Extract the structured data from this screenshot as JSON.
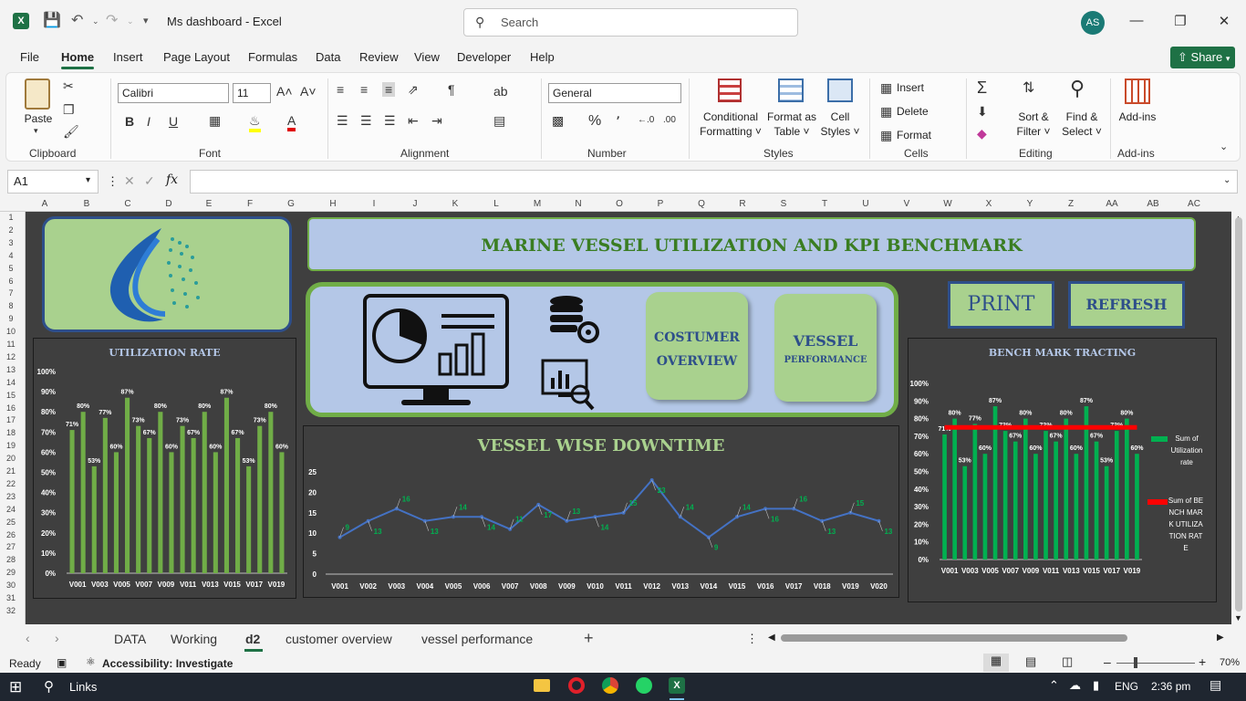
{
  "window": {
    "doc_title": "Ms dashboard  -  Excel",
    "search_placeholder": "Search",
    "avatar": "AS"
  },
  "menu": [
    "File",
    "Home",
    "Insert",
    "Page Layout",
    "Formulas",
    "Data",
    "Review",
    "View",
    "Developer",
    "Help"
  ],
  "share_label": "Share",
  "ribbon": {
    "paste": "Paste",
    "font_name": "Calibri",
    "font_size": "11",
    "number_format": "General",
    "conditional": [
      "Conditional",
      "Formatting"
    ],
    "format_table": [
      "Format as",
      "Table"
    ],
    "cell_styles": [
      "Cell",
      "Styles"
    ],
    "insert": "Insert",
    "delete": "Delete",
    "format": "Format",
    "sort": [
      "Sort &",
      "Filter"
    ],
    "find": [
      "Find &",
      "Select"
    ],
    "addins": "Add-ins",
    "groups": [
      "Clipboard",
      "Font",
      "Alignment",
      "Number",
      "Styles",
      "Cells",
      "Editing",
      "Add-ins"
    ]
  },
  "formula_bar": {
    "name_box": "A1",
    "fx": "fx"
  },
  "columns": [
    "A",
    "B",
    "C",
    "D",
    "E",
    "F",
    "G",
    "H",
    "I",
    "J",
    "K",
    "L",
    "M",
    "N",
    "O",
    "P",
    "Q",
    "R",
    "S",
    "T",
    "U",
    "V",
    "W",
    "X",
    "Y",
    "Z",
    "AA",
    "AB",
    "AC"
  ],
  "rows": [
    "1",
    "2",
    "3",
    "4",
    "5",
    "6",
    "7",
    "8",
    "9",
    "10",
    "11",
    "12",
    "13",
    "14",
    "15",
    "16",
    "17",
    "18",
    "19",
    "20",
    "21",
    "22",
    "23",
    "24",
    "25",
    "26",
    "27",
    "28",
    "29",
    "30",
    "31",
    "32"
  ],
  "dashboard": {
    "title": "MARINE VESSEL UTILIZATION AND KPI BENCHMARK",
    "btn_customer": [
      "COSTUMER",
      "OVERVIEW"
    ],
    "btn_vessel": [
      "VESSEL",
      "PERFORMANCE"
    ],
    "btn_print": "PRINT",
    "btn_refresh": "REFRESH",
    "colors": {
      "bg": "#3f3f3f",
      "green": "#a9d18e",
      "blue": "#b4c7e7",
      "bar": "#70ad47",
      "bench_bar": "#00b050",
      "line": "#4472c4",
      "bench_line": "#ff0000"
    }
  },
  "chart_data": [
    {
      "type": "bar",
      "title": "UTILIZATION RATE",
      "categories": [
        "V001",
        "V002",
        "V003",
        "V004",
        "V005",
        "V006",
        "V007",
        "V008",
        "V009",
        "V010",
        "V011",
        "V012",
        "V013",
        "V014",
        "V015",
        "V016",
        "V017",
        "V018",
        "V019",
        "V020"
      ],
      "tick_labels": [
        "V001",
        "V003",
        "V005",
        "V007",
        "V009",
        "V011",
        "V013",
        "V015",
        "V017",
        "V019"
      ],
      "values": [
        71,
        80,
        53,
        77,
        60,
        87,
        73,
        67,
        80,
        60,
        73,
        67,
        80,
        60,
        87,
        67,
        53,
        73,
        80,
        60
      ],
      "y_ticks": [
        "0%",
        "10%",
        "20%",
        "30%",
        "40%",
        "50%",
        "60%",
        "70%",
        "80%",
        "90%",
        "100%"
      ],
      "ylim": [
        0,
        100
      ]
    },
    {
      "type": "line",
      "title": "VESSEL WISE DOWNTIME",
      "categories": [
        "V001",
        "V002",
        "V003",
        "V004",
        "V005",
        "V006",
        "V007",
        "V008",
        "V009",
        "V010",
        "V011",
        "V012",
        "V013",
        "V014",
        "V015",
        "V016",
        "V017",
        "V018",
        "V019",
        "V020"
      ],
      "values": [
        9,
        13,
        16,
        13,
        14,
        14,
        11,
        17,
        13,
        14,
        15,
        23,
        14,
        9,
        14,
        16,
        16,
        13,
        15,
        13
      ],
      "y_ticks": [
        "0",
        "5",
        "10",
        "15",
        "20",
        "25"
      ],
      "ylim": [
        0,
        25
      ]
    },
    {
      "type": "bar",
      "title": "BENCH MARK TRACTING",
      "categories": [
        "V001",
        "V002",
        "V003",
        "V004",
        "V005",
        "V006",
        "V007",
        "V008",
        "V009",
        "V010",
        "V011",
        "V012",
        "V013",
        "V014",
        "V015",
        "V016",
        "V017",
        "V018",
        "V019",
        "V020"
      ],
      "tick_labels": [
        "V001",
        "V003",
        "V005",
        "V007",
        "V009",
        "V011",
        "V013",
        "V015",
        "V017",
        "V019"
      ],
      "series": [
        {
          "name": "Sum of Utilization rate",
          "values": [
            71,
            80,
            53,
            77,
            60,
            87,
            73,
            67,
            80,
            60,
            73,
            67,
            80,
            60,
            87,
            67,
            53,
            73,
            80,
            60
          ]
        },
        {
          "name": "Sum of BENCH MARK UTILIZATION RATE",
          "values": [
            75,
            75,
            75,
            75,
            75,
            75,
            75,
            75,
            75,
            75,
            75,
            75,
            75,
            75,
            75,
            75,
            75,
            75,
            75,
            75
          ]
        }
      ],
      "y_ticks": [
        "0%",
        "10%",
        "20%",
        "30%",
        "40%",
        "50%",
        "60%",
        "70%",
        "80%",
        "90%",
        "100%"
      ],
      "ylim": [
        0,
        100
      ],
      "legend": "right"
    }
  ],
  "tabs": [
    "DATA",
    "Working",
    "d2",
    "customer overview",
    "vessel performance"
  ],
  "status": {
    "ready": "Ready",
    "accessibility": "Accessibility: Investigate",
    "zoom": "70%"
  },
  "taskbar": {
    "search": "Links",
    "lang": "ENG",
    "time": "2:36 pm"
  }
}
